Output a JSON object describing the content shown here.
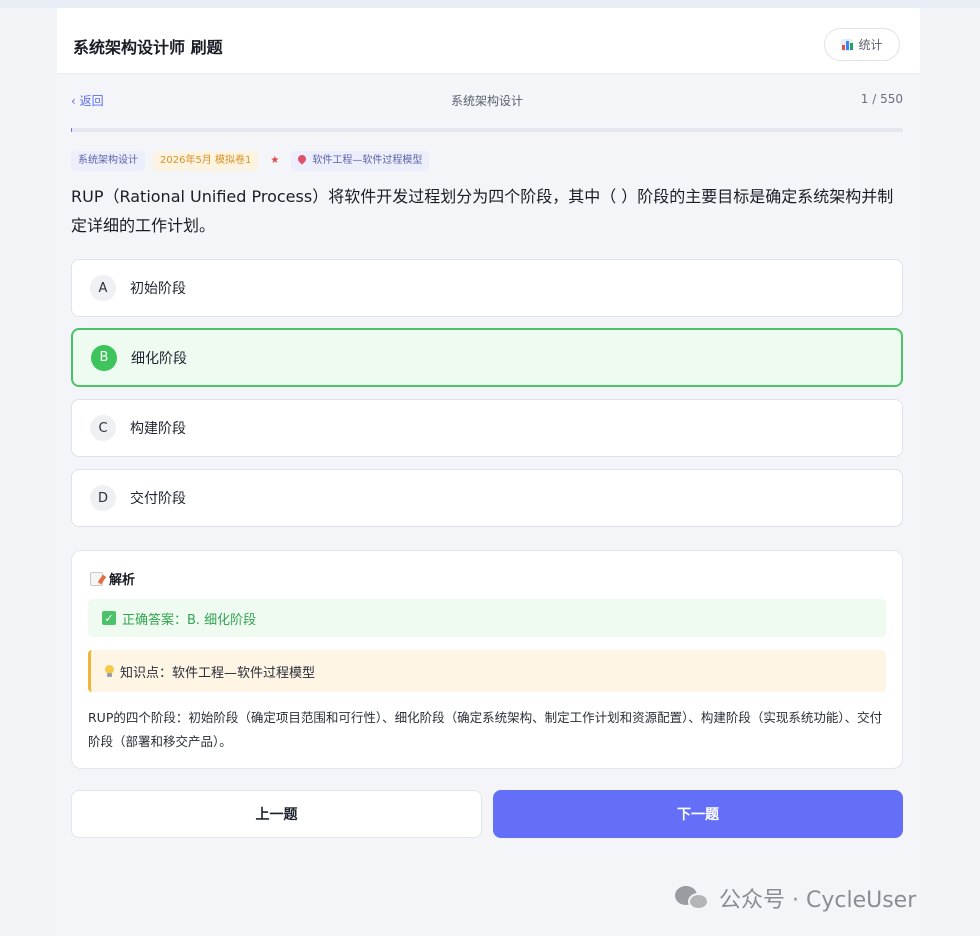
{
  "header": {
    "title": "系统架构设计师 刷题",
    "stats_label": "统计",
    "stats_icon": "bar-chart-icon"
  },
  "nav": {
    "back_label": "‹ 返回",
    "category": "系统架构设计",
    "progress_text": "1 / 550",
    "progress_fraction": 0.0018
  },
  "tags": [
    "系统架构设计",
    "2026年5月 模拟卷1",
    "★",
    "软件工程—软件过程模型"
  ],
  "question": "RUP（Rational Unified Process）将软件开发过程划分为四个阶段，其中（ ）阶段的主要目标是确定系统架构并制定详细的工作计划。",
  "options": [
    {
      "letter": "A",
      "text": "初始阶段",
      "state": "normal"
    },
    {
      "letter": "B",
      "text": "细化阶段",
      "state": "correct"
    },
    {
      "letter": "C",
      "text": "构建阶段",
      "state": "normal"
    },
    {
      "letter": "D",
      "text": "交付阶段",
      "state": "normal"
    }
  ],
  "analysis": {
    "title": "解析",
    "answer": "正确答案：B. 细化阶段",
    "knowledge": "知识点：软件工程—软件过程模型",
    "explanation": "RUP的四个阶段：初始阶段（确定项目范围和可行性）、细化阶段（确定系统架构、制定工作计划和资源配置）、构建阶段（实现系统功能）、交付阶段（部署和移交产品）。"
  },
  "buttons": {
    "prev": "上一题",
    "next": "下一题"
  },
  "watermark": "公众号 · CycleUser",
  "colors": {
    "accent": "#636ff7",
    "correct": "#3ec45c",
    "warning": "#f0b43c"
  }
}
